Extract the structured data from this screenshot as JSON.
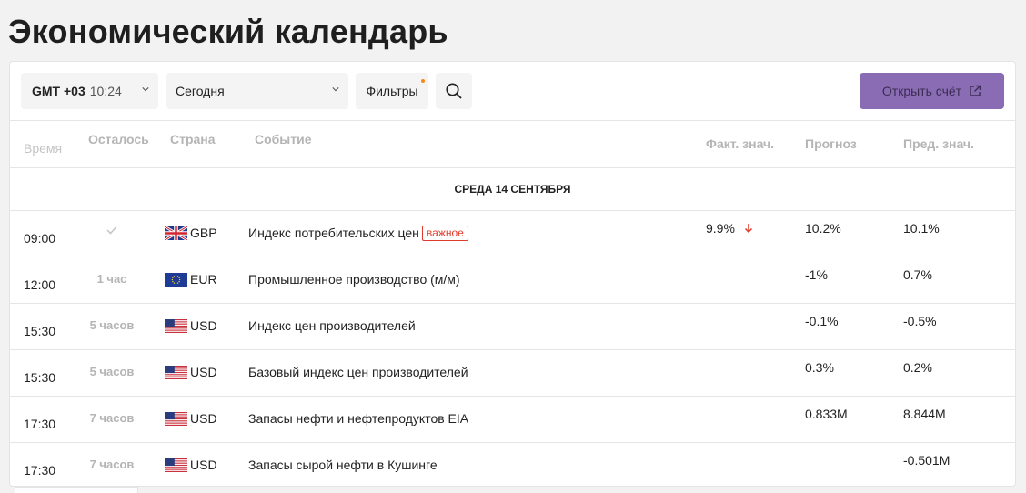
{
  "page": {
    "title": "Экономический календарь"
  },
  "toolbar": {
    "timezone_offset": "GMT +03",
    "timezone_time": "10:24",
    "date_selected": "Сегодня",
    "filters_label": "Фильтры",
    "open_account_label": "Открыть счёт",
    "colors": {
      "accent": "#8a6cb4",
      "filter_dot": "#f28a1f"
    }
  },
  "table": {
    "headers": {
      "time": "Время",
      "left": "Осталось",
      "country": "Страна",
      "event": "Событие",
      "actual": "Факт. знач.",
      "forecast": "Прогноз",
      "previous": "Пред. знач."
    },
    "day_label": "СРЕДА 14 СЕНТЯБРЯ",
    "rows": [
      {
        "time": "09:00",
        "left": "",
        "left_icon": "check-icon",
        "flag": "gb-flag-icon",
        "currency": "GBP",
        "event": "Индекс потребительских цен",
        "badge": "важное",
        "actual": "9.9%",
        "actual_trend": "down-arrow-icon",
        "forecast": "10.2%",
        "previous": "10.1%"
      },
      {
        "time": "12:00",
        "left": "1 час",
        "flag": "eu-flag-icon",
        "currency": "EUR",
        "event": "Промышленное производство (м/м)",
        "badge": "",
        "actual": "",
        "forecast": "-1%",
        "previous": "0.7%"
      },
      {
        "time": "15:30",
        "left": "5 часов",
        "flag": "us-flag-icon",
        "currency": "USD",
        "event": "Индекс цен производителей",
        "badge": "",
        "actual": "",
        "forecast": "-0.1%",
        "previous": "-0.5%"
      },
      {
        "time": "15:30",
        "left": "5 часов",
        "flag": "us-flag-icon",
        "currency": "USD",
        "event": "Базовый индекс цен производителей",
        "badge": "",
        "actual": "",
        "forecast": "0.3%",
        "previous": "0.2%"
      },
      {
        "time": "17:30",
        "left": "7 часов",
        "flag": "us-flag-icon",
        "currency": "USD",
        "event": "Запасы нефти и нефтепродуктов EIA",
        "badge": "",
        "actual": "",
        "forecast": "0.833M",
        "previous": "8.844M"
      },
      {
        "time": "17:30",
        "left": "7 часов",
        "flag": "us-flag-icon",
        "currency": "USD",
        "event": "Запасы сырой нефти в Кушинге",
        "badge": "",
        "actual": "",
        "forecast": "",
        "previous": "-0.501M"
      }
    ]
  }
}
